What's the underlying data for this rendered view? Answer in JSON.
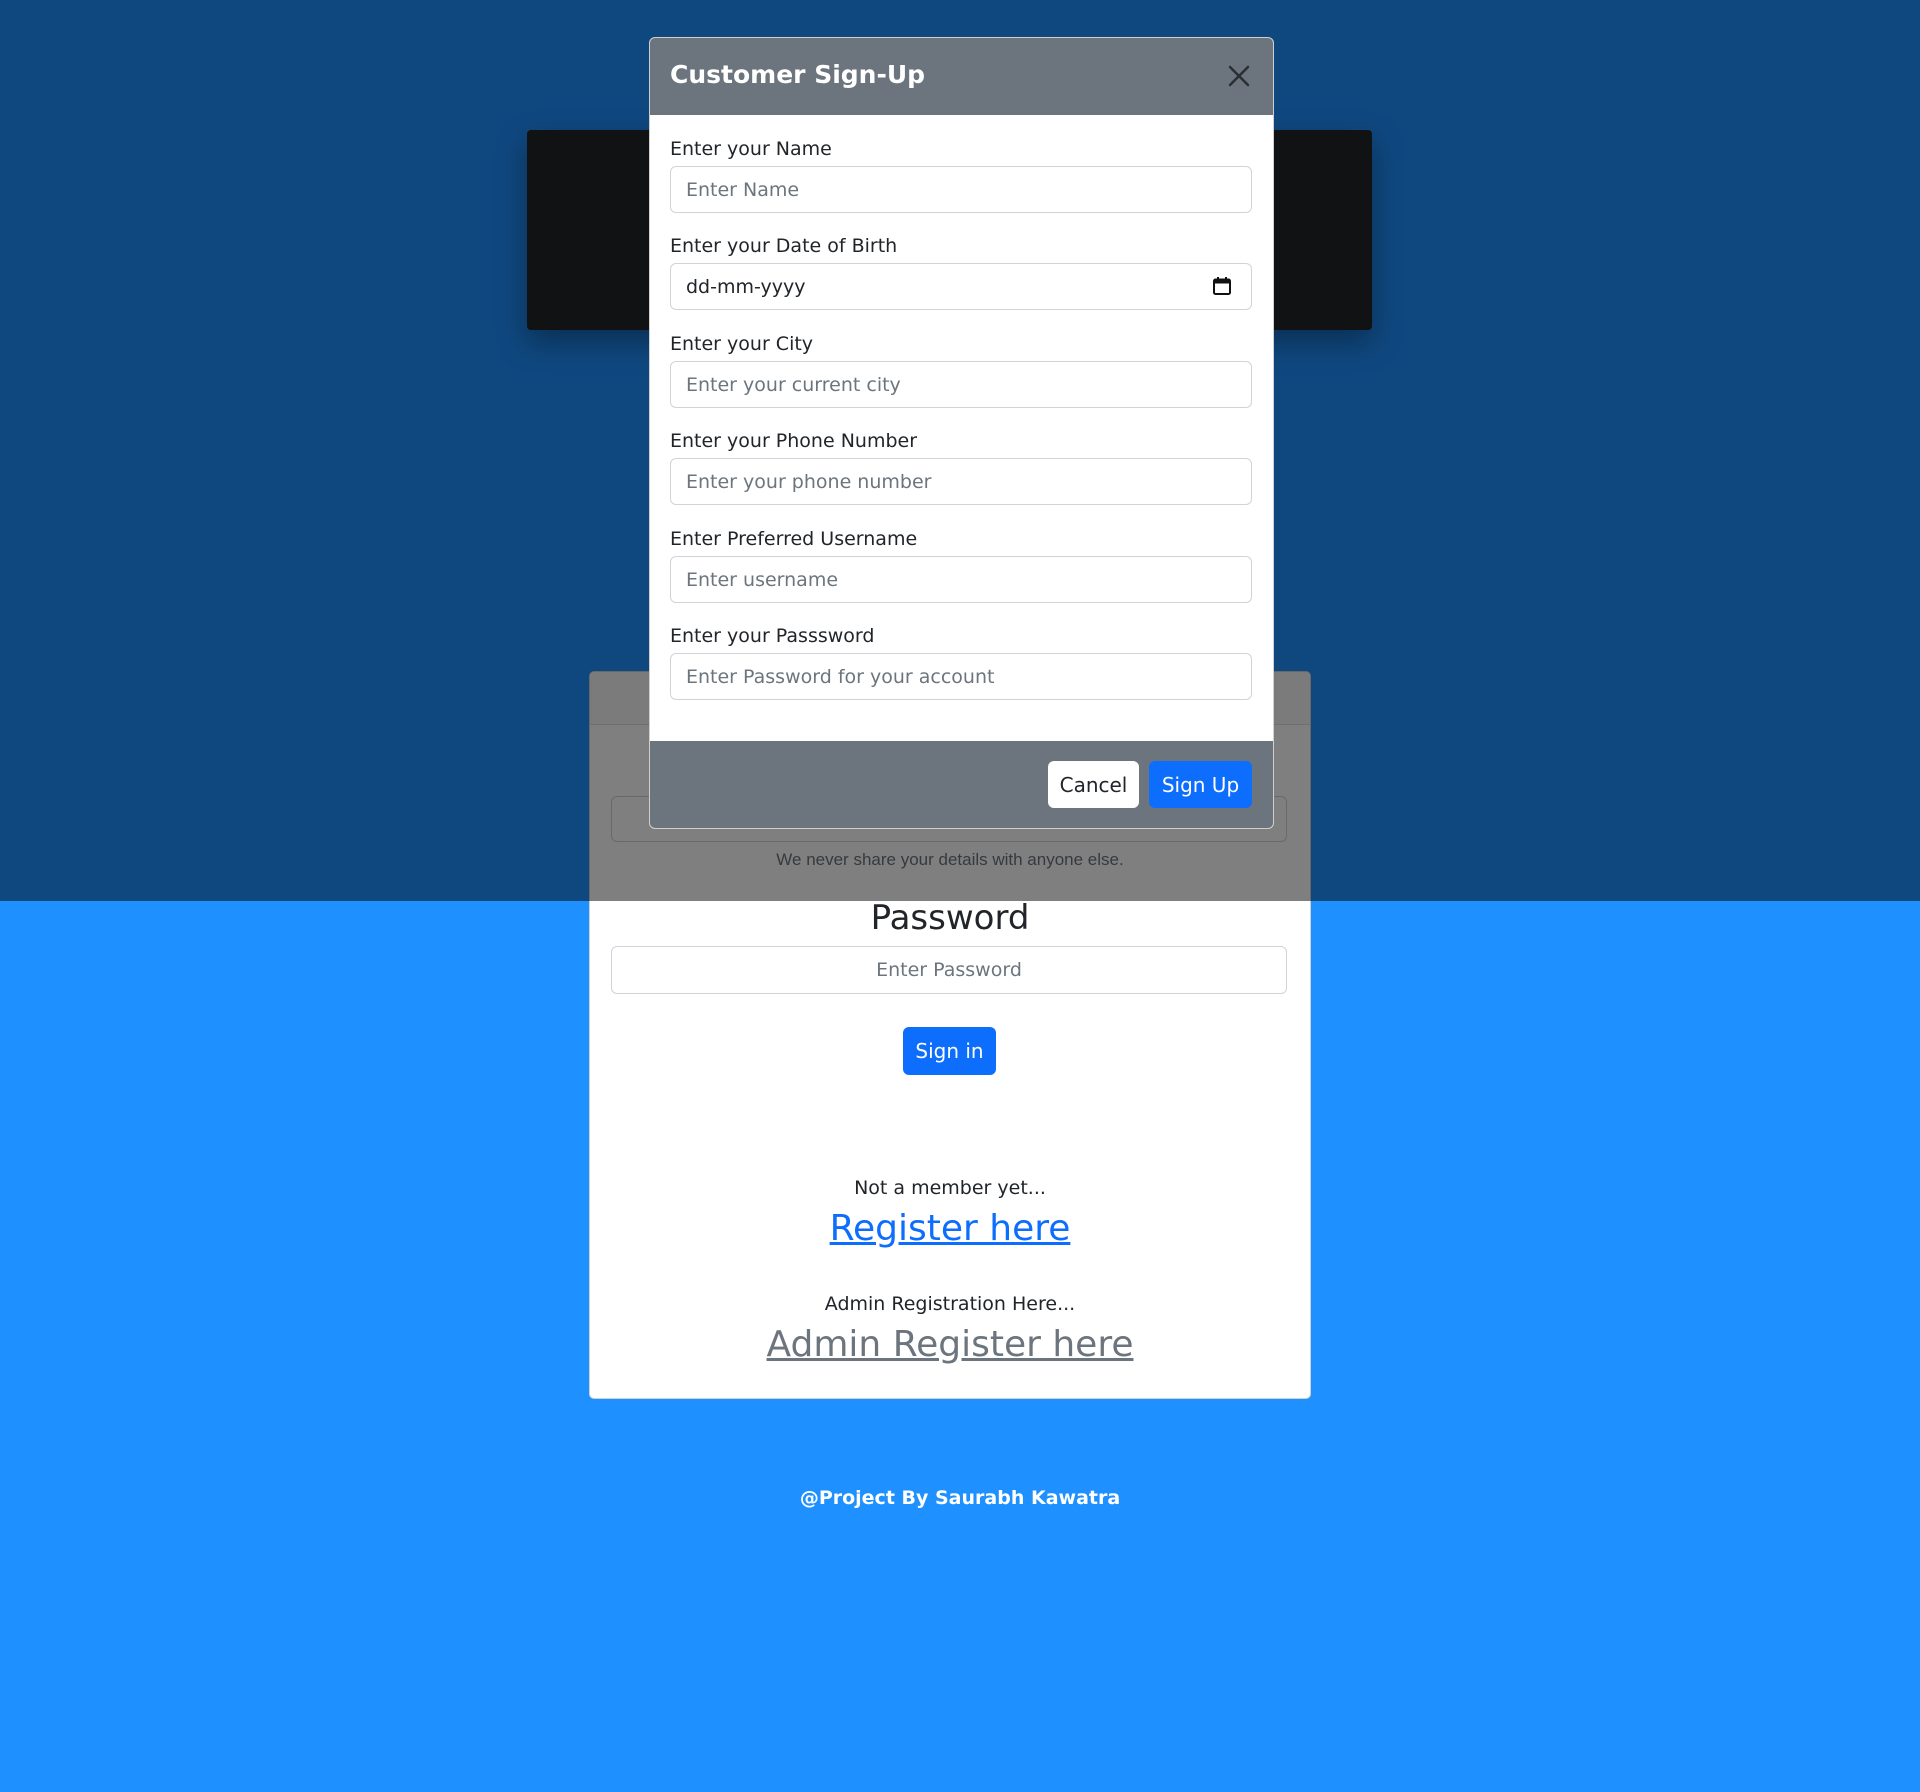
{
  "login": {
    "email_help": "We never share your details with anyone else.",
    "password_label": "Password",
    "password_placeholder": "Enter Password",
    "signin_label": "Sign in",
    "member_text": "Not a member yet...",
    "register_link": "Register here",
    "admin_text": "Admin Registration Here...",
    "admin_link": "Admin Register here"
  },
  "footer": {
    "credit": "@Project By Saurabh Kawatra"
  },
  "modal": {
    "title": "Customer Sign-Up",
    "fields": [
      {
        "label": "Enter your Name",
        "placeholder": "Enter Name"
      },
      {
        "label": "Enter your Date of Birth",
        "value": "dd-mm-yyyy"
      },
      {
        "label": "Enter your City",
        "placeholder": "Enter your current city"
      },
      {
        "label": "Enter your Phone Number",
        "placeholder": "Enter your phone number"
      },
      {
        "label": "Enter Preferred Username",
        "placeholder": "Enter username"
      },
      {
        "label": "Enter your Passsword",
        "placeholder": "Enter Password for your account"
      }
    ],
    "cancel_label": "Cancel",
    "signup_label": "Sign Up"
  },
  "colors": {
    "page_background": "#1e90ff",
    "primary": "#0d6efd",
    "modal_header": "#6c757d",
    "dark_card": "#212529",
    "admin_link": "#6c757d"
  }
}
